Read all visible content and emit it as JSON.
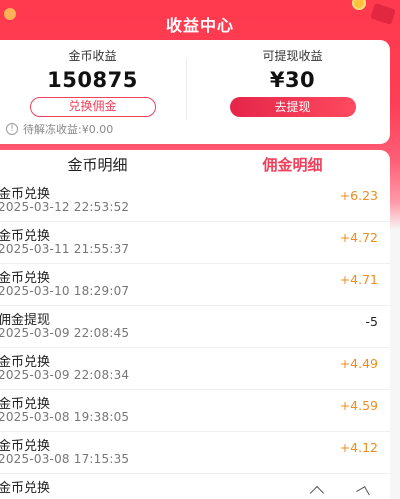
{
  "header": {
    "title": "收益中心"
  },
  "summary": {
    "coins_label": "金币收益",
    "coins_value": "150875",
    "exchange_button": "兑换佣金",
    "withdrawable_label": "可提现收益",
    "withdrawable_value": "¥30",
    "withdraw_button": "去提现",
    "pending_text": "待解冻收益:¥0.00"
  },
  "tabs": [
    "金币明细",
    "佣金明细"
  ],
  "transactions": [
    {
      "title": "金币兑换",
      "date": "2025-03-12 22:53:52",
      "amount": "+6.23"
    },
    {
      "title": "金币兑换",
      "date": "2025-03-11 21:55:37",
      "amount": "+4.72"
    },
    {
      "title": "金币兑换",
      "date": "2025-03-10 18:29:07",
      "amount": "+4.71"
    },
    {
      "title": "佣金提现",
      "date": "2025-03-09 22:08:45",
      "amount": "-5"
    },
    {
      "title": "金币兑换",
      "date": "2025-03-09 22:08:34",
      "amount": "+4.49"
    },
    {
      "title": "金币兑换",
      "date": "2025-03-08 19:38:05",
      "amount": "+4.59"
    },
    {
      "title": "金币兑换",
      "date": "2025-03-08 17:15:35",
      "amount": "+4.12"
    },
    {
      "title": "金币兑换",
      "date": "",
      "amount": ""
    }
  ],
  "colors": {
    "accent": "#f0415c",
    "positive": "#f08c1e",
    "header": "#ff3a4e"
  }
}
